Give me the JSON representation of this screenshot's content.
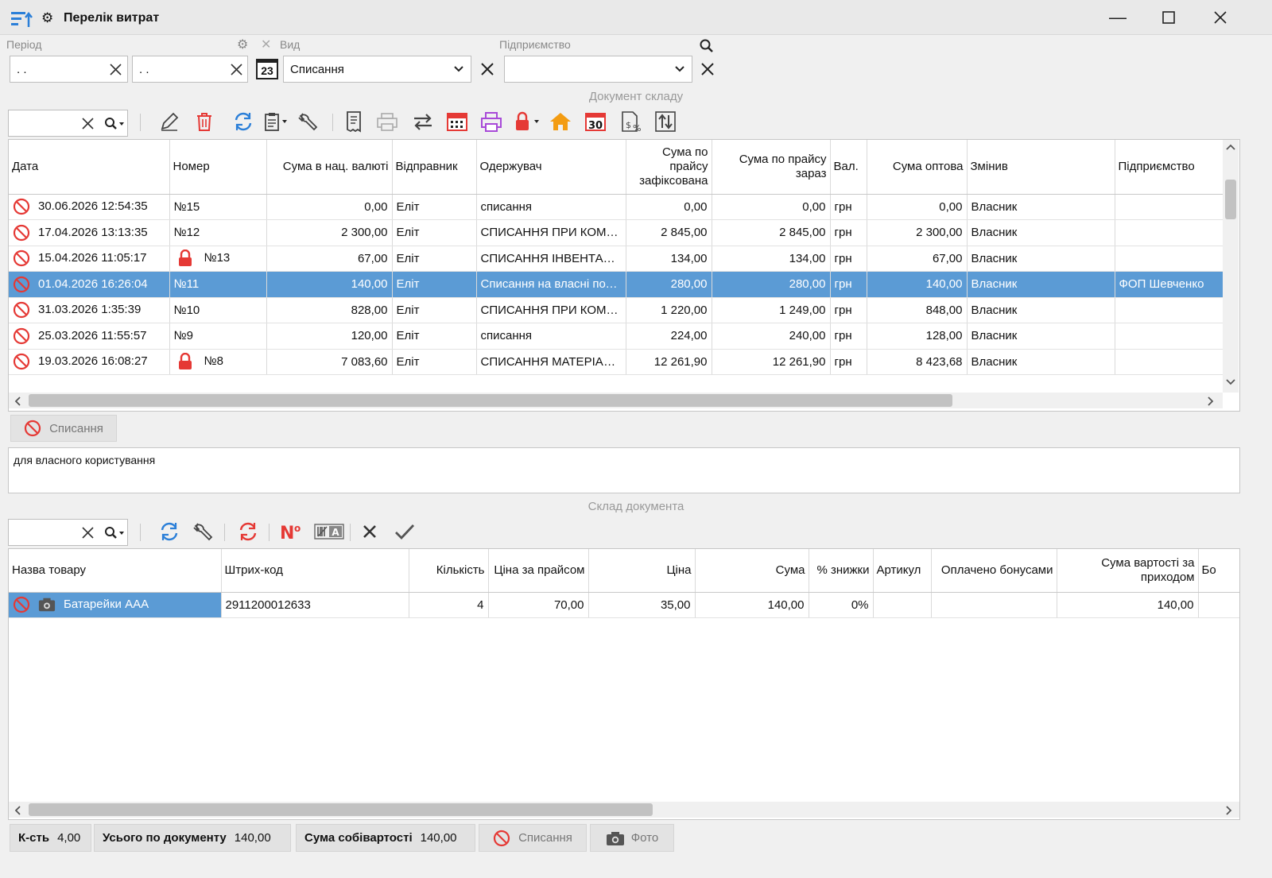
{
  "window": {
    "title": "Перелік витрат"
  },
  "filters": {
    "period_label": "Період",
    "period_from": ". .",
    "period_to": ". .",
    "calendar_day": "23",
    "type_label": "Вид",
    "type_value": "Списання",
    "enterprise_label": "Підприємство",
    "enterprise_value": ""
  },
  "top_section_title": "Документ складу",
  "docs_grid": {
    "columns": [
      "Дата",
      "Номер",
      "Сума в нац. валюті",
      "Відправник",
      "Одержувач",
      "Сума по прайсу зафіксована",
      "Сума по прайсу зараз",
      "Вал.",
      "Сума оптова",
      "Змінив",
      "Підприємство"
    ],
    "rows": [
      {
        "date": "30.06.2026 12:54:35",
        "locked": false,
        "number": "№15",
        "sum_nat": "0,00",
        "sender": "Еліт",
        "receiver": "списання",
        "price_fixed": "0,00",
        "price_now": "0,00",
        "cur": "грн",
        "wholesale": "0,00",
        "changed": "Власник",
        "enterprise": ""
      },
      {
        "date": "17.04.2026 13:13:35",
        "locked": false,
        "number": "№12",
        "sum_nat": "2 300,00",
        "sender": "Еліт",
        "receiver": "СПИСАННЯ ПРИ КОМПЛЕКТАЦІЇ",
        "price_fixed": "2 845,00",
        "price_now": "2 845,00",
        "cur": "грн",
        "wholesale": "2 300,00",
        "changed": "Власник",
        "enterprise": ""
      },
      {
        "date": "15.04.2026 11:05:17",
        "locked": true,
        "number": "№13",
        "sum_nat": "67,00",
        "sender": "Еліт",
        "receiver": "СПИСАННЯ ІНВЕНТАРИЗАЦІЯ",
        "price_fixed": "134,00",
        "price_now": "134,00",
        "cur": "грн",
        "wholesale": "67,00",
        "changed": "Власник",
        "enterprise": ""
      },
      {
        "date": "01.04.2026 16:26:04",
        "locked": false,
        "number": "№11",
        "sum_nat": "140,00",
        "sender": "Еліт",
        "receiver": "Списання на власні потреби",
        "price_fixed": "280,00",
        "price_now": "280,00",
        "cur": "грн",
        "wholesale": "140,00",
        "changed": "Власник",
        "enterprise": "ФОП Шевченко",
        "selected": true
      },
      {
        "date": "31.03.2026 1:35:39",
        "locked": false,
        "number": "№10",
        "sum_nat": "828,00",
        "sender": "Еліт",
        "receiver": "СПИСАННЯ ПРИ КОМПЛЕКТАЦІЇ",
        "price_fixed": "1 220,00",
        "price_now": "1 249,00",
        "cur": "грн",
        "wholesale": "848,00",
        "changed": "Власник",
        "enterprise": ""
      },
      {
        "date": "25.03.2026 11:55:57",
        "locked": false,
        "number": "№9",
        "sum_nat": "120,00",
        "sender": "Еліт",
        "receiver": "списання",
        "price_fixed": "224,00",
        "price_now": "240,00",
        "cur": "грн",
        "wholesale": "128,00",
        "changed": "Власник",
        "enterprise": ""
      },
      {
        "date": "19.03.2026 16:08:27",
        "locked": true,
        "number": "№8",
        "sum_nat": "7 083,60",
        "sender": "Еліт",
        "receiver": "СПИСАННЯ МАТЕРІАЛІВ",
        "price_fixed": "12 261,90",
        "price_now": "12 261,90",
        "cur": "грн",
        "wholesale": "8 423,68",
        "changed": "Власник",
        "enterprise": ""
      }
    ]
  },
  "doc_type_button": "Списання",
  "comment": "для власного користування",
  "bottom_section_title": "Склад документа",
  "items_grid": {
    "columns": [
      "Назва товару",
      "Штрих-код",
      "Кількість",
      "Ціна за прайсом",
      "Ціна",
      "Сума",
      "% знижки",
      "Артикул",
      "Оплачено бонусами",
      "Сума вартості за приходом",
      "Бо"
    ],
    "rows": [
      {
        "name": "Батарейки ААА",
        "barcode": "2911200012633",
        "qty": "4",
        "price_list": "70,00",
        "price": "35,00",
        "sum": "140,00",
        "discount": "0%",
        "article": "",
        "bonus": "",
        "cost_sum": "140,00",
        "extra": ""
      }
    ]
  },
  "footer": {
    "qty_label": "К-сть",
    "qty_value": "4,00",
    "total_label": "Усього по документу",
    "total_value": "140,00",
    "cost_label": "Сума собівартості",
    "cost_value": "140,00",
    "writeoff_label": "Списання",
    "photo_label": "Фото"
  },
  "colors": {
    "selection": "#5b9bd5",
    "accent_blue": "#2b7fd8",
    "danger_red": "#e53935"
  }
}
